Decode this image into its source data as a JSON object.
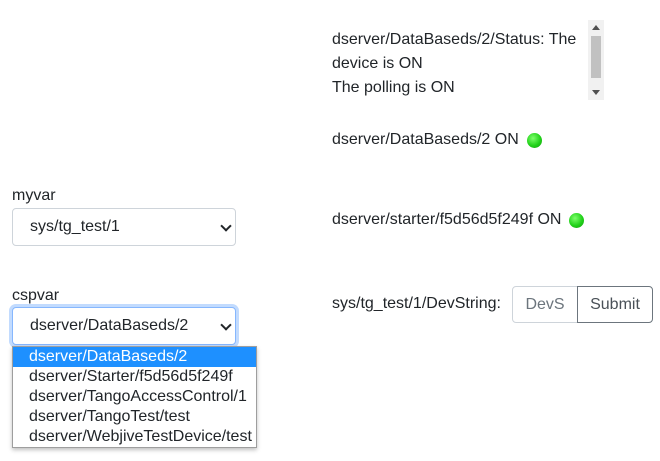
{
  "status_panel": {
    "lines": [
      "dserver/DataBaseds/2/Status: The device is ON",
      "The polling is ON"
    ]
  },
  "devices": [
    {
      "name": "dserver/DataBaseds/2",
      "state": "ON",
      "led_color": "#22d21a"
    },
    {
      "name": "dserver/starter/f5d56d5f249f",
      "state": "ON",
      "led_color": "#22d21a"
    }
  ],
  "myvar": {
    "label": "myvar",
    "value": "sys/tg_test/1"
  },
  "cspvar": {
    "label": "cspvar",
    "value": "dserver/DataBaseds/2",
    "options": [
      "dserver/DataBaseds/2",
      "dserver/Starter/f5d56d5f249f",
      "dserver/TangoAccessControl/1",
      "dserver/TangoTest/test",
      "dserver/WebjiveTestDevice/test"
    ]
  },
  "command": {
    "label": "sys/tg_test/1/DevString:",
    "input_value": "DevS",
    "submit_label": "Submit"
  },
  "colors": {
    "accent": "#1e90ff",
    "led_on": "#22d21a"
  }
}
